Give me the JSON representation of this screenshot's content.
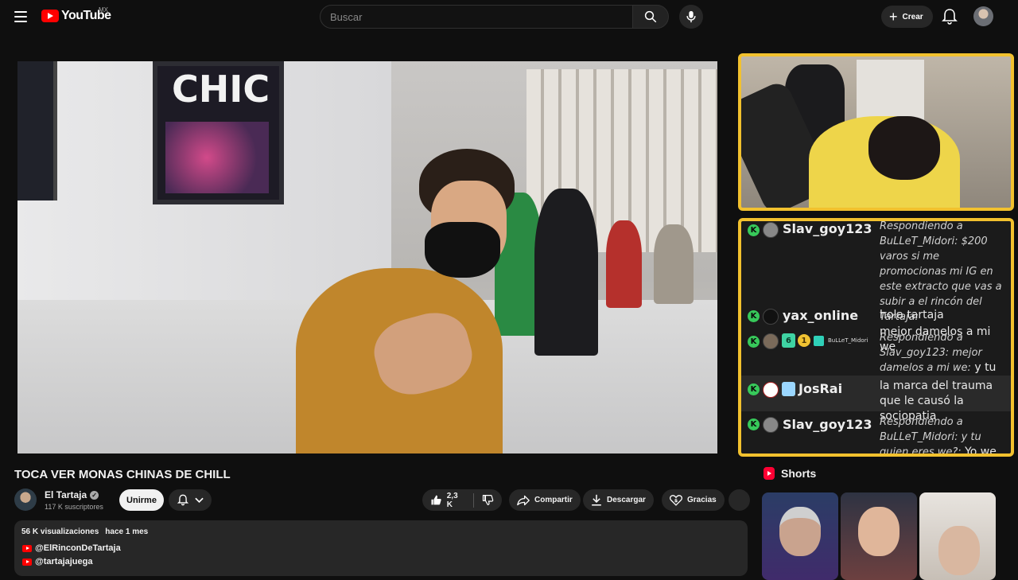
{
  "header": {
    "logo_text": "YouTube",
    "country": "MX",
    "search_placeholder": "Buscar",
    "create_label": "Crear"
  },
  "video": {
    "title": "TOCA VER MONAS CHINAS DE CHILL",
    "overlay_sign": "CHIC"
  },
  "channel": {
    "name": "El Tartaja",
    "subscribers": "117 K suscriptores",
    "join_label": "Unirme"
  },
  "actions": {
    "likes": "2,3 K",
    "share": "Compartir",
    "download": "Descargar",
    "thanks": "Gracias"
  },
  "description": {
    "views": "56 K visualizaciones",
    "age": "hace 1 mes",
    "links": [
      "@ElRinconDeTartaja",
      "@tartajajuega"
    ]
  },
  "chat": [
    {
      "user": "Slav_goy123",
      "reply": "Respondiendo a BuLLeT_Midori: $200 varos si me promocionas mi IG en este extracto que vas a subir a el rincón del Tartaja:",
      "text": "mejor damelos a mi we"
    },
    {
      "user": "yax_online",
      "reply": "",
      "text": "hola tartaja"
    },
    {
      "user": "BuLLeT_Midori",
      "badge_num": "1",
      "reply": "Respondiendo a Slav_goy123: mejor damelos a mi we:",
      "text": "y tu quien eres we?"
    },
    {
      "user": "JosRai",
      "reply": "",
      "text": "la marca del trauma que le causó la sociopatia"
    },
    {
      "user": "Slav_goy123",
      "reply": "Respondiendo a BuLLeT_Midori: y tu quien eres we?:",
      "text": "Yo we"
    }
  ],
  "shorts": {
    "title": "Shorts"
  },
  "colors": {
    "accent_red": "#ff0000",
    "stream_border": "#f2c12e",
    "chat_badge": "#37c95a"
  }
}
